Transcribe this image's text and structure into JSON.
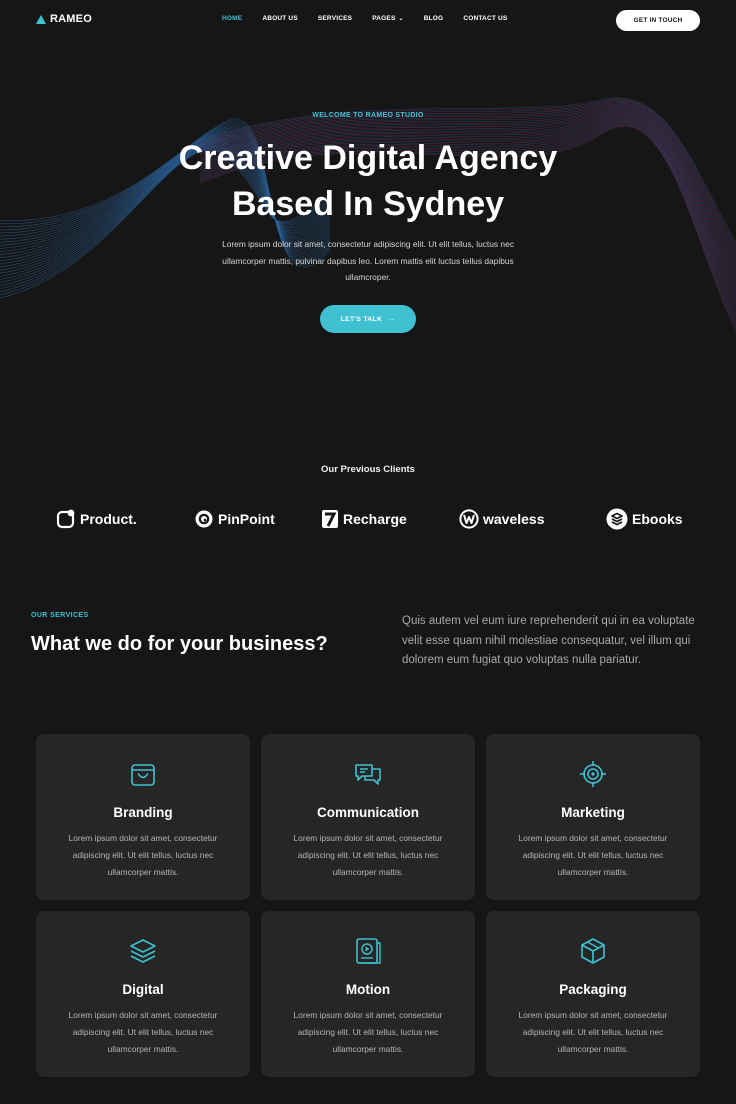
{
  "brand": {
    "name": "RAMEO"
  },
  "nav": {
    "items": [
      {
        "label": "HOME",
        "active": true
      },
      {
        "label": "ABOUT US"
      },
      {
        "label": "SERVICES"
      },
      {
        "label": "PAGES"
      },
      {
        "label": "BLOG"
      },
      {
        "label": "CONTACT US"
      }
    ],
    "cta": "GET IN TOUCH"
  },
  "hero": {
    "eyebrow": "WELCOME TO RAMEO STUDIO",
    "title_line1": "Creative Digital Agency",
    "title_line2": "Based In Sydney",
    "subtitle": "Lorem ipsum dolor sit amet, consectetur adipiscing elit. Ut elit tellus, luctus nec ullamcorper mattis, pulvinar dapibus leo. Lorem mattis elit luctus tellus dapibus ullamcroper.",
    "button": "LET'S TALK",
    "button_arrow": "→"
  },
  "clients": {
    "title": "Our Previous Clients",
    "logos": [
      {
        "name": "Product.",
        "icon": "product-logo-icon"
      },
      {
        "name": "PinPoint",
        "icon": "pinpoint-logo-icon"
      },
      {
        "name": "Recharge",
        "icon": "recharge-logo-icon"
      },
      {
        "name": "waveless",
        "icon": "waveless-logo-icon"
      },
      {
        "name": "Ebooks",
        "icon": "ebooks-logo-icon"
      }
    ]
  },
  "services": {
    "eyebrow": "OUR SERVICES",
    "title": "What we do for your business?",
    "intro": "Quis autem vel eum iure reprehenderit qui in ea voluptate velit esse quam nihil molestiae consequatur, vel illum qui dolorem eum fugiat quo voluptas nulla pariatur.",
    "cards": [
      {
        "title": "Branding",
        "icon": "shopping-bag-icon",
        "text": "Lorem ipsum dolor sit amet, consectetur adipiscing elit. Ut elit tellus, luctus nec ullamcorper mattis."
      },
      {
        "title": "Communication",
        "icon": "chat-bubbles-icon",
        "text": "Lorem ipsum dolor sit amet, consectetur adipiscing elit. Ut elit tellus, luctus nec ullamcorper mattis."
      },
      {
        "title": "Marketing",
        "icon": "target-crosshair-icon",
        "text": "Lorem ipsum dolor sit amet, consectetur adipiscing elit. Ut elit tellus, luctus nec ullamcorper mattis."
      },
      {
        "title": "Digital",
        "icon": "layers-stack-icon",
        "text": "Lorem ipsum dolor sit amet, consectetur adipiscing elit. Ut elit tellus, luctus nec ullamcorper mattis."
      },
      {
        "title": "Motion",
        "icon": "video-player-icon",
        "text": "Lorem ipsum dolor sit amet, consectetur adipiscing elit. Ut elit tellus, luctus nec ullamcorper mattis."
      },
      {
        "title": "Packaging",
        "icon": "package-box-icon",
        "text": "Lorem ipsum dolor sit amet, consectetur adipiscing elit. Ut elit tellus, luctus nec ullamcorper mattis."
      }
    ]
  },
  "colors": {
    "accent": "#3fc1d1",
    "background": "#161616",
    "card": "#262626",
    "wave_blue": "#2d6aa8",
    "wave_pink": "#a8336e"
  }
}
